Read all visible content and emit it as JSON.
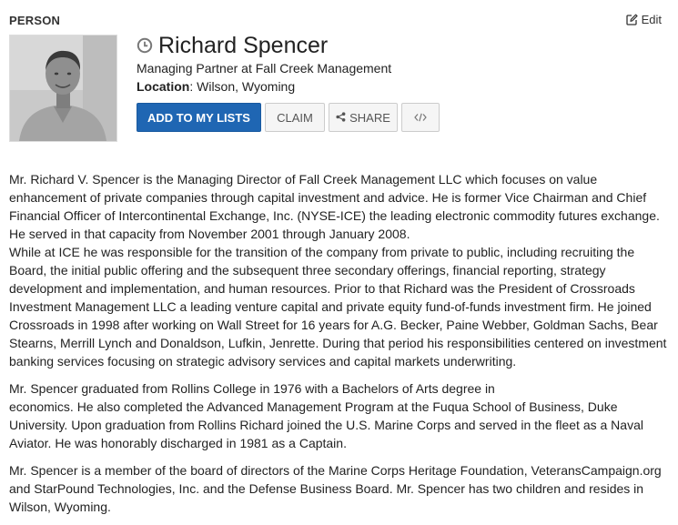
{
  "section": {
    "label": "PERSON",
    "edit_label": "Edit"
  },
  "icons": {
    "edit": "edit-pencil-square-icon",
    "history": "clock-icon",
    "share": "share-icon",
    "embed": "code-icon"
  },
  "colors": {
    "primary_button": "#1f66b3",
    "text": "#222222"
  },
  "person": {
    "name": "Richard Spencer",
    "title": "Managing Partner at Fall Creek Management",
    "location_label": "Location",
    "location": "Wilson, Wyoming"
  },
  "actions": {
    "add_to_lists": "ADD TO MY LISTS",
    "claim": "CLAIM",
    "share": "SHARE"
  },
  "bio": {
    "paragraphs": [
      "Mr. Richard V. Spencer is the Managing Director of Fall Creek Management LLC which focuses on value enhancement of private companies through capital investment and advice. He is former Vice Chairman and Chief Financial Officer of Intercontinental Exchange, Inc. (NYSE-ICE) the leading electronic commodity futures exchange. He served in that capacity from November 2001 through January 2008.\nWhile at ICE he was responsible for the transition of the company from private to public, including recruiting the Board, the initial public offering and the subsequent three secondary offerings, financial reporting, strategy development and implementation, and human resources. Prior to that Richard was the President of Crossroads Investment Management LLC a leading venture capital and private equity fund-of-funds investment firm. He joined Crossroads in 1998 after working on Wall Street for 16 years for A.G. Becker, Paine Webber, Goldman Sachs, Bear Stearns, Merrill Lynch and Donaldson, Lufkin, Jenrette. During that period his responsibilities centered on investment banking services focusing on strategic advisory services and capital markets underwriting.",
      "Mr. Spencer graduated from Rollins College in 1976 with a Bachelors of Arts degree in\neconomics. He also completed the Advanced Management Program at the Fuqua School of Business, Duke University. Upon graduation from Rollins Richard joined the U.S. Marine Corps and served in the fleet as a Naval Aviator. He was honorably discharged in 1981 as a Captain.",
      "Mr. Spencer is a member of the board of directors of the Marine Corps Heritage Foundation, VeteransCampaign.org and StarPound Technologies, Inc. and the Defense Business Board. Mr. Spencer has two children and resides in Wilson, Wyoming."
    ]
  }
}
